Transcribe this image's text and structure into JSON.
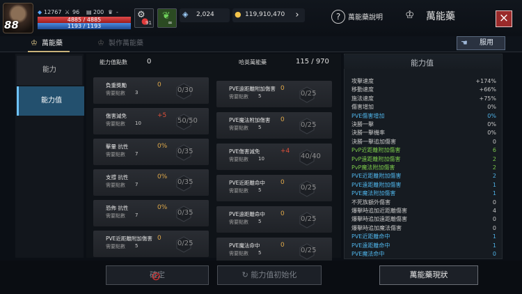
{
  "player": {
    "level": "88",
    "stat1": "12767",
    "stat2": "96",
    "stat3": "200",
    "stat4": "-",
    "hp": "4885 / 4885",
    "mp": "1193 / 1193",
    "potion_count": "91"
  },
  "currency": {
    "crystals": "2,024",
    "gold": "119,910,470"
  },
  "header": {
    "help_label": "萬能藥說明",
    "title": "萬能藥"
  },
  "tabs": [
    {
      "label": "萬能藥"
    },
    {
      "label": "製作萬能藥"
    }
  ],
  "use_button": "服用",
  "nav": [
    {
      "label": "能力"
    },
    {
      "label": "能力值"
    }
  ],
  "points": {
    "label": "能力值點數",
    "value": "0"
  },
  "collection": {
    "label": "哈英萬能藥",
    "value": "115 / 970"
  },
  "left_cards": [
    {
      "name": "負重獎勵",
      "req_label": "需要點數",
      "req": "3",
      "bonus": "0",
      "progress": "0/30",
      "bonus_color": "#e0a94a"
    },
    {
      "name": "傷害減免",
      "req_label": "需要點數",
      "req": "10",
      "bonus": "+5",
      "progress": "50/50",
      "bonus_color": "#e0503a"
    },
    {
      "name": "擊暈 抗性",
      "req_label": "需要點數",
      "req": "7",
      "bonus": "0%",
      "progress": "0/35",
      "bonus_color": "#e0a94a"
    },
    {
      "name": "支撐 抗性",
      "req_label": "需要點數",
      "req": "7",
      "bonus": "0%",
      "progress": "0/35",
      "bonus_color": "#e0a94a"
    },
    {
      "name": "恐佈 抗性",
      "req_label": "需要點數",
      "req": "7",
      "bonus": "0%",
      "progress": "0/35",
      "bonus_color": "#e0a94a"
    },
    {
      "name": "PVE近距離附加傷害",
      "req_label": "需要點數",
      "req": "5",
      "bonus": "0",
      "progress": "0/25",
      "bonus_color": "#e0a94a"
    }
  ],
  "right_cards": [
    {
      "name": "PVE遠距離附加傷害",
      "req_label": "需要點數",
      "req": "5",
      "bonus": "0",
      "progress": "0/25",
      "bonus_color": "#e0a94a"
    },
    {
      "name": "PVE魔法附加傷害",
      "req_label": "需要點數",
      "req": "5",
      "bonus": "0",
      "progress": "0/25",
      "bonus_color": "#e0a94a"
    },
    {
      "name": "PVE傷害減免",
      "req_label": "需要點數",
      "req": "10",
      "bonus": "+4",
      "progress": "40/40",
      "bonus_color": "#e0503a"
    },
    {
      "name": "PVE近距離命中",
      "req_label": "需要點數",
      "req": "5",
      "bonus": "0",
      "progress": "0/25",
      "bonus_color": "#e0a94a"
    },
    {
      "name": "PVE遠距離命中",
      "req_label": "需要點數",
      "req": "5",
      "bonus": "0",
      "progress": "0/25",
      "bonus_color": "#e0a94a"
    },
    {
      "name": "PVE魔法命中",
      "req_label": "需要點數",
      "req": "5",
      "bonus": "0",
      "progress": "0/25",
      "bonus_color": "#e0a94a"
    }
  ],
  "stats_panel": {
    "title": "能力值",
    "rows": [
      {
        "label": "攻擊速度",
        "value": "+174%",
        "color": "#c8c8c8"
      },
      {
        "label": "移動速度",
        "value": "+66%",
        "color": "#c8c8c8"
      },
      {
        "label": "施法速度",
        "value": "+75%",
        "color": "#c8c8c8"
      },
      {
        "label": "傷害增加",
        "value": "0%",
        "color": "#c8c8c8"
      },
      {
        "label": "PVE傷害增加",
        "value": "0%",
        "color": "#4fb3e8"
      },
      {
        "label": "決勝一擊",
        "value": "0%",
        "color": "#c8c8c8"
      },
      {
        "label": "決勝一擊機率",
        "value": "0%",
        "color": "#c8c8c8"
      },
      {
        "label": "決勝一擊追加傷害",
        "value": "0",
        "color": "#c8c8c8"
      },
      {
        "label": "PvP近距離附加傷害",
        "value": "6",
        "color": "#7bc94a"
      },
      {
        "label": "PvP遠距離附加傷害",
        "value": "2",
        "color": "#7bc94a"
      },
      {
        "label": "PvP魔法附加傷害",
        "value": "2",
        "color": "#7bc94a"
      },
      {
        "label": "PVE近距離附加傷害",
        "value": "2",
        "color": "#4fb3e8"
      },
      {
        "label": "PVE遠距離附加傷害",
        "value": "1",
        "color": "#4fb3e8"
      },
      {
        "label": "PVE魔法附加傷害",
        "value": "1",
        "color": "#4fb3e8"
      },
      {
        "label": "不死族額外傷害",
        "value": "0",
        "color": "#c8c8c8"
      },
      {
        "label": "爆擊時追加近距離傷害",
        "value": "4",
        "color": "#c8c8c8"
      },
      {
        "label": "爆擊時追加遠距離傷害",
        "value": "0",
        "color": "#c8c8c8"
      },
      {
        "label": "爆擊時追加魔法傷害",
        "value": "0",
        "color": "#c8c8c8"
      },
      {
        "label": "PVE近距離命中",
        "value": "1",
        "color": "#4fb3e8"
      },
      {
        "label": "PVE遠距離命中",
        "value": "1",
        "color": "#4fb3e8"
      },
      {
        "label": "PVE魔法命中",
        "value": "0",
        "color": "#4fb3e8"
      }
    ]
  },
  "buttons": {
    "apply": "確定",
    "reset": "能力值初始化",
    "status": "萬能藥現狀"
  }
}
